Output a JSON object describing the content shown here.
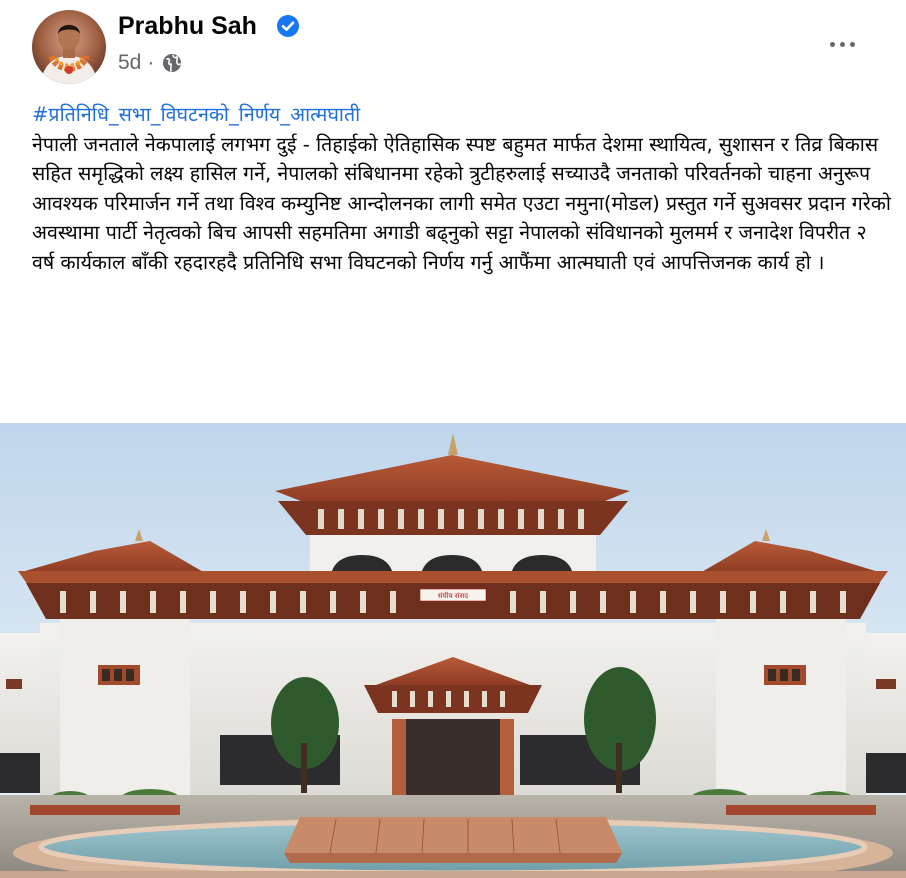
{
  "post": {
    "author": "Prabhu Sah",
    "verified": true,
    "time": "5d",
    "separator": "·",
    "privacy_icon": "globe-icon",
    "more_icon": "more-dots-icon",
    "hashtag": "#प्रतिनिधि_सभा_विघटनको_निर्णय_आत्मघाती",
    "body": "नेपाली जनताले नेकपालाई लगभग दुई - तिहाईको ऐतिहासिक स्पष्ट बहुमत मार्फत देशमा स्थायित्व, सुशासन र तिव्र बिकास सहित समृद्धिको लक्ष्य हासिल गर्ने, नेपालको संबिधानमा रहेको त्रुटीहरुलाई सच्याउदै जनताको परिवर्तनको चाहना अनुरूप आवश्यक परिमार्जन गर्ने तथा विश्व कम्युनिष्ट आन्दोलनका लागी समेत एउटा नमुना(मोडल) प्रस्तुत गर्ने सुअवसर प्रदान गरेको अवस्थामा पार्टी नेतृत्वको बिच आपसी सहमतिमा अगाडी बढ्नुको सट्टा नेपालको संविधानको मुलमर्म र जनादेश विपरीत २ वर्ष कार्यकाल बाँकी रहदारहदै प्रतिनिधि सभा विघटनको निर्णय गर्नु आफैंमा आत्मघाती एवं आपत्तिजनक कार्य हो ।"
  },
  "photo": {
    "subject": "parliament-building",
    "sign_text": "संघीय संसद"
  },
  "colors": {
    "text": "#050505",
    "secondary": "#65676b",
    "link": "#216fdb",
    "verified": "#1877f2"
  }
}
